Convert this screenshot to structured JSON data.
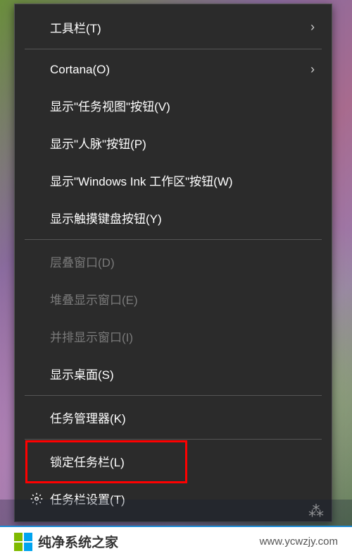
{
  "menu": {
    "toolbars": "工具栏(T)",
    "cortana": "Cortana(O)",
    "show_task_view": "显示\"任务视图\"按钮(V)",
    "show_people": "显示\"人脉\"按钮(P)",
    "show_ink": "显示\"Windows Ink 工作区\"按钮(W)",
    "show_touch_kb": "显示触摸键盘按钮(Y)",
    "cascade": "层叠窗口(D)",
    "stacked": "堆叠显示窗口(E)",
    "sidebyside": "并排显示窗口(I)",
    "show_desktop": "显示桌面(S)",
    "task_manager": "任务管理器(K)",
    "lock_taskbar": "锁定任务栏(L)",
    "taskbar_settings": "任务栏设置(T)"
  },
  "watermark": {
    "text": "纯净系统之家",
    "url": "www.ycwzjy.com"
  },
  "highlight_target": "lock_taskbar",
  "colors": {
    "menu_bg": "#2b2b2b",
    "highlight": "#ff0000",
    "logo_green": "#7fba00",
    "logo_blue": "#00a4ef",
    "logo_orange": "#f25022",
    "logo_yellow": "#ffb900"
  }
}
